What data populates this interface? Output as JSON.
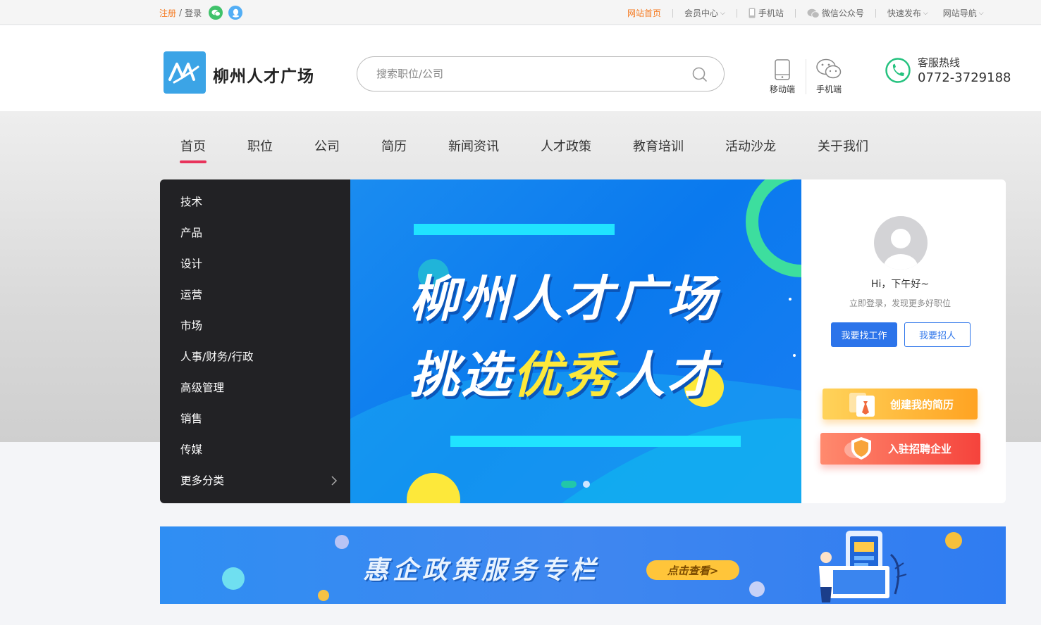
{
  "topbar": {
    "register": "注册",
    "slash": "/",
    "login": "登录",
    "links": [
      {
        "label": "网站首页",
        "icon": "",
        "dropdown": false
      },
      {
        "label": "会员中心",
        "icon": "",
        "dropdown": true
      },
      {
        "label": "手机站",
        "icon": "mobile-icon",
        "dropdown": false
      },
      {
        "label": "微信公众号",
        "icon": "wechat-icon",
        "dropdown": false
      },
      {
        "label": "快速发布",
        "icon": "",
        "dropdown": true
      },
      {
        "label": "网站导航",
        "icon": "",
        "dropdown": true
      }
    ]
  },
  "header": {
    "site_name": "柳州人才广场",
    "search_placeholder": "搜索职位/公司",
    "mobile_label": "移动端",
    "wechat_label": "手机端",
    "hotline_label": "客服热线",
    "hotline_number": "0772-3729188"
  },
  "nav": [
    "首页",
    "职位",
    "公司",
    "简历",
    "新闻资讯",
    "人才政策",
    "教育培训",
    "活动沙龙",
    "关于我们"
  ],
  "categories": [
    "技术",
    "产品",
    "设计",
    "运营",
    "市场",
    "人事/财务/行政",
    "高级管理",
    "销售",
    "传媒",
    "更多分类"
  ],
  "banner": {
    "line1": "柳州人才广场",
    "line2_a": "挑选",
    "line2_hl": "优秀",
    "line2_b": "人才"
  },
  "usercard": {
    "greeting": "Hi，下午好~",
    "sub": "立即登录，发现更多好职位",
    "find_job": "我要找工作",
    "hire": "我要招人",
    "create_resume": "创建我的简历",
    "join_company": "入驻招聘企业"
  },
  "policy": {
    "title": "惠企政策服务专栏",
    "button": "点击查看>"
  }
}
